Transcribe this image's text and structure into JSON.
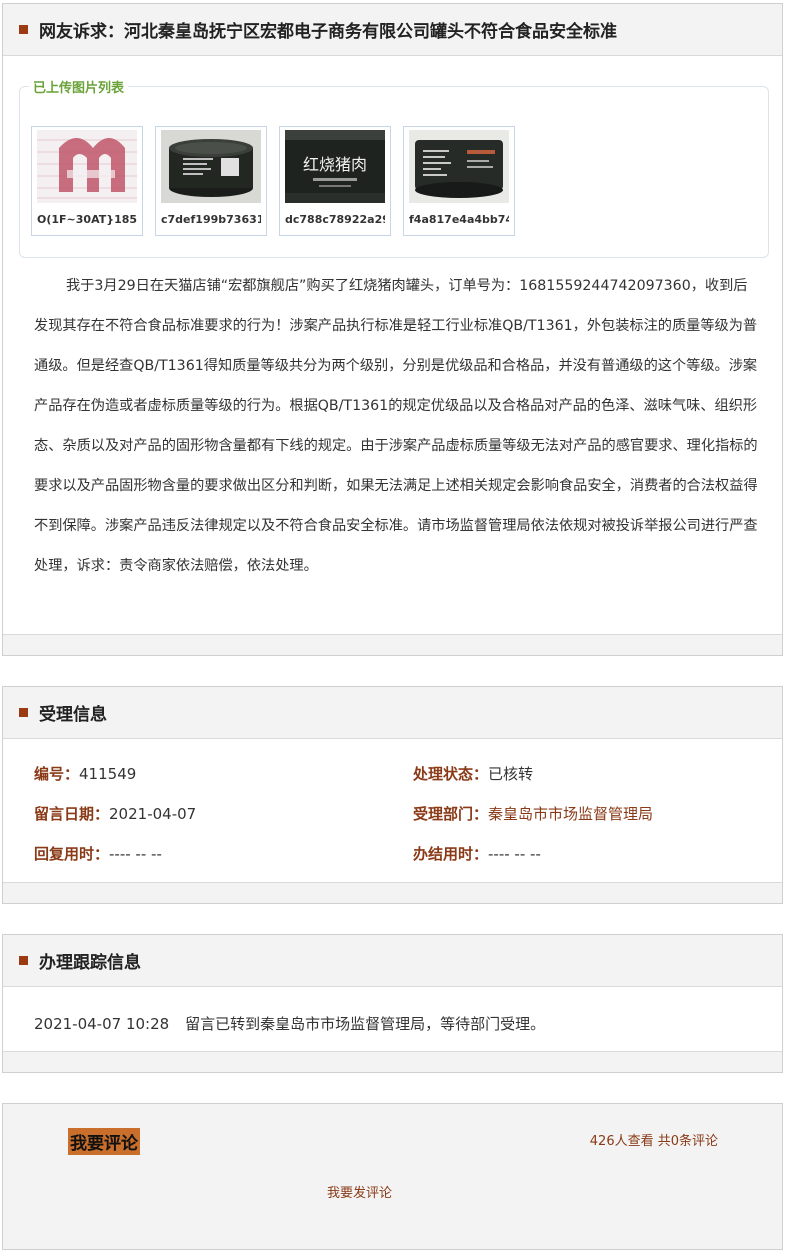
{
  "complaint": {
    "title": "网友诉求：河北秦皇岛抚宁区宏都电子商务有限公司罐头不符合食品安全标准",
    "uploads_label": "已上传图片列表",
    "images": [
      {
        "caption": "O(1F~30AT}185(",
        "icon": "document-image"
      },
      {
        "caption": "c7def199b73631(",
        "icon": "can-image"
      },
      {
        "caption": "dc788c78922a29!",
        "icon": "can-label-image"
      },
      {
        "caption": "f4a817e4a4bb74",
        "icon": "can-image"
      }
    ],
    "can_label_text": "红烧猪肉",
    "body": "我于3月29日在天猫店铺“宏都旗舰店”购买了红烧猪肉罐头，订单号为：1681559244742097360，收到后发现其存在不符合食品标准要求的行为！涉案产品执行标准是轻工行业标准QB/T1361，外包装标注的质量等级为普通级。但是经查QB/T1361得知质量等级共分为两个级别，分别是优级品和合格品，并没有普通级的这个等级。涉案产品存在伪造或者虚标质量等级的行为。根据QB/T1361的规定优级品以及合格品对产品的色泽、滋味气味、组织形态、杂质以及对产品的固形物含量都有下线的规定。由于涉案产品虚标质量等级无法对产品的感官要求、理化指标的要求以及产品固形物含量的要求做出区分和判断，如果无法满足上述相关规定会影响食品安全，消费者的合法权益得不到保障。涉案产品违反法律规定以及不符合食品安全标准。请市场监督管理局依法依规对被投诉举报公司进行严查处理，诉求：责令商家依法赔偿，依法处理。"
  },
  "acceptance": {
    "title": "受理信息",
    "number_label": "编号：",
    "number": "411549",
    "status_label": "处理状态：",
    "status": "已核转",
    "date_label": "留言日期：",
    "date": "2021-04-07",
    "dept_label": "受理部门：",
    "dept": "秦皇岛市市场监督管理局",
    "reply_label": "回复用时：",
    "reply": "---- -- --",
    "finish_label": "办结用时：",
    "finish": "---- -- --"
  },
  "tracking": {
    "title": "办理跟踪信息",
    "time": "2021-04-07 10:28",
    "text": "留言已转到秦皇岛市市场监督管理局，等待部门受理。"
  },
  "comments": {
    "button": "我要评论",
    "stats": "426人查看 共0条评论",
    "post": "我要发评论"
  },
  "colors": {
    "accent": "#9b3b14",
    "link": "#8a3a17",
    "legend": "#6aa338"
  }
}
